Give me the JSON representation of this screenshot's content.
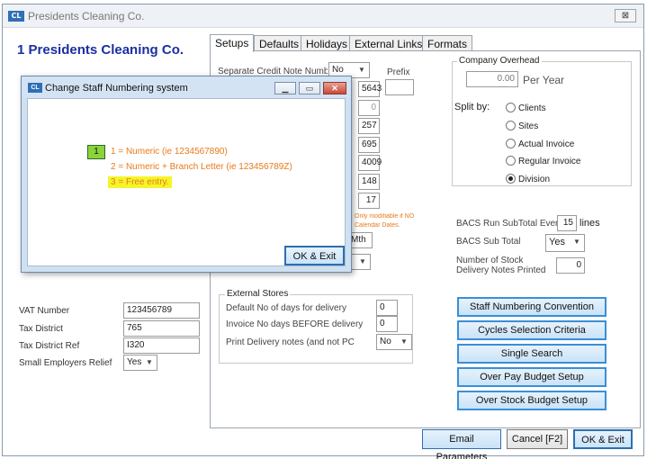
{
  "window": {
    "logo_text": "CL",
    "title": "Presidents Cleaning Co.",
    "close_glyph": "⊠"
  },
  "company": {
    "heading": "1 Presidents Cleaning Co."
  },
  "left_fields": {
    "vat_number_label": "VAT Number",
    "vat_number_value": "123456789",
    "tax_district_label": "Tax District",
    "tax_district_value": "765",
    "tax_district_ref_label": "Tax District Ref",
    "tax_district_ref_value": "I320",
    "small_employers_label": "Small Employers Relief",
    "small_employers_value": "Yes"
  },
  "tabs": [
    {
      "label": "Setups",
      "active": true
    },
    {
      "label": "Defaults"
    },
    {
      "label": "Holidays"
    },
    {
      "label": "External Links"
    },
    {
      "label": "Formats"
    }
  ],
  "setups": {
    "separate_credit_label": "Separate Credit Note Numbe",
    "separate_credit_value": "No",
    "prefix_label": "Prefix",
    "numbers": [
      "5643",
      "0",
      "257",
      "695",
      "4009",
      "148",
      "17"
    ],
    "note_text_1": "Only modifiable if NO",
    "note_text_2": "Calendar Dates.",
    "period_value": "Mth"
  },
  "company_overhead": {
    "title": "Company Overhead",
    "value": "0.00",
    "per_year": "Per Year",
    "split_by_label": "Split by:",
    "options": [
      {
        "label": "Clients",
        "selected": false
      },
      {
        "label": "Sites",
        "selected": false
      },
      {
        "label": "Actual Invoice",
        "selected": false
      },
      {
        "label": "Regular Invoice",
        "selected": false
      },
      {
        "label": "Division",
        "selected": true
      }
    ]
  },
  "bacs": {
    "run_subtotal_label": "BACS Run SubTotal Every",
    "run_subtotal_value": "15",
    "run_subtotal_unit": "lines",
    "sub_total_label": "BACS Sub Total",
    "sub_total_value": "Yes",
    "stock_notes_label_1": "Number of Stock",
    "stock_notes_label_2": "Delivery Notes Printed",
    "stock_notes_value": "0"
  },
  "external_stores": {
    "title": "External Stores",
    "default_days_label": "Default No of days for delivery",
    "default_days_value": "0",
    "invoice_days_label": "Invoice No days BEFORE delivery",
    "invoice_days_value": "0",
    "print_notes_label": "Print Delivery notes (and not PC",
    "print_notes_value": "No"
  },
  "action_buttons": [
    "Staff Numbering Convention",
    "Cycles Selection Criteria",
    "Single Search",
    "Over Pay Budget Setup",
    "Over Stock Budget Setup"
  ],
  "footer": {
    "email_label": "Email Parameters",
    "cancel_label": "Cancel [F2]",
    "ok_label": "OK & Exit"
  },
  "dialog": {
    "logo_text": "CL",
    "title": "Change Staff Numbering system",
    "selected_value": "1",
    "options": [
      "1 = Numeric (ie 1234567890)",
      "2 = Numeric + Branch Letter (ie 123456789Z)",
      "3 = Free entry."
    ],
    "ok_label": "OK & Exit",
    "colors": {
      "option_text": "#e87a1a",
      "highlight": "#f5f52a",
      "selector": "#8ad43a"
    }
  }
}
